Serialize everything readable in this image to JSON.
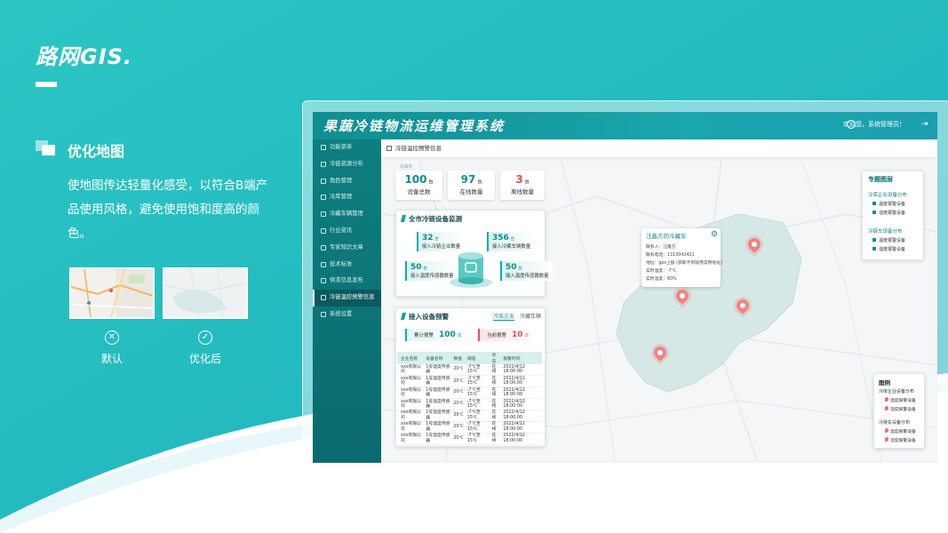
{
  "slide": {
    "brand": "路网GIS.",
    "section_title": "优化地图",
    "description": "使地图传达轻量化感受，以符合B端产品使用风格，避免使用饱和度高的颜色。",
    "thumb_default_label": "默认",
    "thumb_optimized_label": "优化后"
  },
  "app": {
    "title": "果蔬冷链物流运维管理系统",
    "user_text": "欢迎您，系统管理员！",
    "breadcrumb": "冷链温控预警信息",
    "sidebar": [
      {
        "label": "功能菜单",
        "active": false
      },
      {
        "label": "冷链资源分布",
        "active": false
      },
      {
        "label": "角色管理",
        "active": false
      },
      {
        "label": "冷库管理",
        "active": false
      },
      {
        "label": "冷藏车辆管理",
        "active": false
      },
      {
        "label": "行业资讯",
        "active": false
      },
      {
        "label": "专家知识文章",
        "active": false
      },
      {
        "label": "技术标准",
        "active": false
      },
      {
        "label": "供求信息发布",
        "active": false
      },
      {
        "label": "冷链温控预警信息",
        "active": true
      },
      {
        "label": "系统设置",
        "active": false
      }
    ]
  },
  "map": {
    "city_label": "庆阳市",
    "stats": [
      {
        "value": "100",
        "unit": "台",
        "label": "设备总数",
        "color": "#0f8e92"
      },
      {
        "value": "97",
        "unit": "台",
        "label": "在线数量",
        "color": "#0f8e92"
      },
      {
        "value": "3",
        "unit": "台",
        "label": "离线数量",
        "color": "#e05151"
      }
    ],
    "monitor": {
      "title": "全市冷链设备监测",
      "items": [
        {
          "value": "32",
          "unit": "台",
          "label": "接入冷链企业数量"
        },
        {
          "value": "356",
          "unit": "台",
          "label": "接入冷藏车辆数量"
        },
        {
          "value": "50",
          "unit": "台",
          "label": "接入温度传感器数量"
        },
        {
          "value": "50",
          "unit": "台",
          "label": "接入温度传感器数量"
        }
      ]
    },
    "alarm": {
      "title": "接入设备预警",
      "tab_active": "冷库企业",
      "tab_other": "冷藏车辆",
      "total_label": "累计报警",
      "total_value": "100",
      "total_unit": "次",
      "pending_label": "当前报警",
      "pending_value": "10",
      "pending_unit": "次",
      "columns": [
        "企业名称",
        "设备名称",
        "数值",
        "阈值",
        "状态",
        "报警时间"
      ],
      "rows": [
        [
          "xxx有限公司",
          "1号温度传感器",
          "20℃",
          "-7℃至15℃",
          "在线",
          "2022/4/12 18:00:00"
        ],
        [
          "xxx有限公司",
          "1号温度传感器",
          "20℃",
          "-7℃至15℃",
          "在线",
          "2022/4/12 18:00:00"
        ],
        [
          "xxx有限公司",
          "1号温度传感器",
          "20℃",
          "-7℃至15℃",
          "在线",
          "2022/4/12 18:00:00"
        ],
        [
          "xxx有限公司",
          "1号温度传感器",
          "20℃",
          "-7℃至15℃",
          "在线",
          "2022/4/12 18:00:00"
        ],
        [
          "xxx有限公司",
          "1号温度传感器",
          "20℃",
          "-7℃至15℃",
          "在线",
          "2022/4/12 18:00:00"
        ],
        [
          "xxx有限公司",
          "1号温度传感器",
          "20℃",
          "-7℃至15℃",
          "在线",
          "2022/4/12 18:00:00"
        ],
        [
          "xxx有限公司",
          "1号温度传感器",
          "20℃",
          "-7℃至15℃",
          "在线",
          "2022/4/12 18:00:00"
        ]
      ]
    },
    "popup": {
      "title": "汪鑫方的冷藏车",
      "lines": [
        "联系人：汪鑫方",
        "联系电话：1313042421",
        "地址：gps上报 (获取不到就用常用地址)",
        "实时温度：-7℃",
        "实时湿度：60%"
      ]
    },
    "layers": {
      "title": "专题图层",
      "groups": [
        {
          "name": "冷库企业设备分布",
          "items": [
            "温度报警设备",
            "湿度报警设备"
          ]
        },
        {
          "name": "冷链车设备分布",
          "items": [
            "温度报警设备",
            "湿度报警设备"
          ]
        }
      ]
    },
    "legend": {
      "title": "图例",
      "groups": [
        {
          "name": "冷库企业设备分布",
          "items": [
            "温度报警设备",
            "湿度报警设备"
          ]
        },
        {
          "name": "冷链车设备分布",
          "items": [
            "温度报警设备",
            "湿度报警设备"
          ]
        }
      ]
    }
  },
  "colors": {
    "accent": "#12a0a0",
    "sidebar": "#0e7e7f",
    "alarm": "#e05151",
    "pin": "#f08383"
  }
}
